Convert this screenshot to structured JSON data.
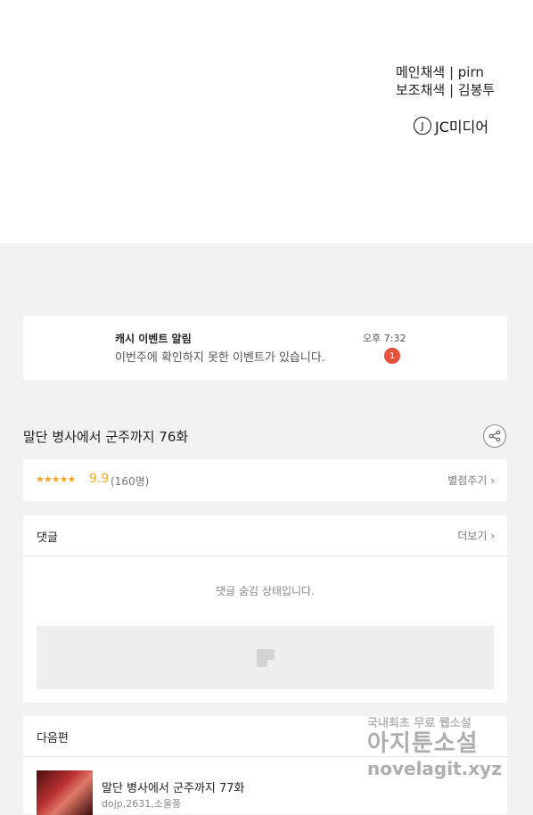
{
  "credits": {
    "line1": "메인채색 | pirn",
    "line2": "보조채색 | 김봉투",
    "logo_mark": "J",
    "logo_text": "JC미디어"
  },
  "notice": {
    "title": "캐시 이벤트 알림",
    "time": "오후 7:32",
    "message": "이번주에 확인하지 못한 이벤트가 있습니다.",
    "badge": "1"
  },
  "episode": {
    "title": "말단 병사에서 군주까지 76화"
  },
  "rating": {
    "stars": "★★★★★",
    "score": "9.9",
    "count": "(160명)",
    "rate_link": "별점주기 ›"
  },
  "comments": {
    "label": "댓글",
    "more": "더보기 ›",
    "hidden_message": "댓글 숨김 상태입니다."
  },
  "next": {
    "label": "다음편",
    "episode_title": "말단 병사에서 군주까지 77화",
    "meta": "dojp,2631,소울풍"
  },
  "watermark": {
    "line1": "국내최초 무료 웹소설",
    "line2": "아지툰소설",
    "line3": "novelagit.xyz"
  },
  "colors": {
    "accent_star": "#f5a623",
    "badge": "#e8503a",
    "background": "#f2f2f2"
  }
}
